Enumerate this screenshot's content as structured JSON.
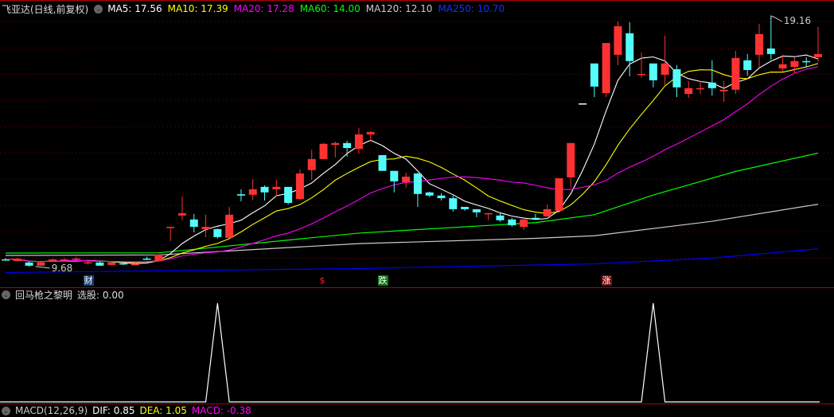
{
  "legend": {
    "stock_title": "飞亚达(日线,前复权)",
    "ma": [
      {
        "label": "MA5: 17.56",
        "color": "#ffffff"
      },
      {
        "label": "MA10: 17.39",
        "color": "#ffff00"
      },
      {
        "label": "MA20: 17.28",
        "color": "#ff00ff"
      },
      {
        "label": "MA60: 14.00",
        "color": "#00ff00"
      },
      {
        "label": "MA120: 12.10",
        "color": "#cccccc"
      },
      {
        "label": "MA250: 10.70",
        "color": "#0000ff"
      }
    ]
  },
  "colors": {
    "up": "#ff3232",
    "down": "#54fcfc",
    "grid": "#7a0000",
    "separator": "#b00000"
  },
  "annotations": {
    "low_label": "9.68",
    "high_label": "19.16"
  },
  "markers": [
    {
      "text": "财",
      "index": 7,
      "bg": "#1c3f77",
      "fg": "#ffffff"
    },
    {
      "text": "$",
      "index": 27,
      "bg": "transparent",
      "fg": "#ff2020"
    },
    {
      "text": "跌",
      "index": 32,
      "bg": "#0a7a0a",
      "fg": "#ffffff"
    },
    {
      "text": "涨",
      "index": 51,
      "bg": "#7a0a0a",
      "fg": "#ffffff"
    }
  ],
  "indicator_panel": {
    "title": "回马枪之黎明",
    "value_label": "选股: 0.00"
  },
  "macd_panel": {
    "title": "MACD(12,26,9)",
    "dif": "DIF: 0.85",
    "dea": "DEA: 1.05",
    "macd": "MACD: -0.38"
  },
  "chart_data": {
    "type": "candlestick",
    "price_range": [
      9.68,
      19.16
    ],
    "candles": [
      [
        9.95,
        9.94,
        10.0,
        9.9
      ],
      [
        9.89,
        9.98,
        10.0,
        9.86
      ],
      [
        9.83,
        9.71,
        9.86,
        9.68
      ],
      [
        9.71,
        9.83,
        9.86,
        9.7
      ],
      [
        9.89,
        9.95,
        9.98,
        9.86
      ],
      [
        9.95,
        9.95,
        10.0,
        9.9
      ],
      [
        9.98,
        9.98,
        10.05,
        9.92
      ],
      [
        9.83,
        9.84,
        9.9,
        9.75
      ],
      [
        9.83,
        9.71,
        9.86,
        9.7
      ],
      [
        9.74,
        9.83,
        9.86,
        9.72
      ],
      [
        9.8,
        9.79,
        9.86,
        9.74
      ],
      [
        9.74,
        9.77,
        9.8,
        9.72
      ],
      [
        9.98,
        9.97,
        10.05,
        9.92
      ],
      [
        9.89,
        10.13,
        10.15,
        9.86
      ],
      [
        11.16,
        11.19,
        11.19,
        10.65
      ],
      [
        11.62,
        11.71,
        12.35,
        11.44
      ],
      [
        11.47,
        11.19,
        11.68,
        10.98
      ],
      [
        11.1,
        11.19,
        11.65,
        10.8
      ],
      [
        11.1,
        10.8,
        11.13,
        10.74
      ],
      [
        10.77,
        11.65,
        11.95,
        10.75
      ],
      [
        12.43,
        12.38,
        12.62,
        12.16
      ],
      [
        12.41,
        12.62,
        13.01,
        12.22
      ],
      [
        12.71,
        12.5,
        12.77,
        12.19
      ],
      [
        12.62,
        12.71,
        12.98,
        12.35
      ],
      [
        12.71,
        12.1,
        12.71,
        12.04
      ],
      [
        12.25,
        13.22,
        13.38,
        12.2
      ],
      [
        13.35,
        13.77,
        14.13,
        12.98
      ],
      [
        13.77,
        14.35,
        14.38,
        13.77
      ],
      [
        14.31,
        14.38,
        14.44,
        13.83
      ],
      [
        14.38,
        14.19,
        14.47,
        13.86
      ],
      [
        14.16,
        14.71,
        14.95,
        13.98
      ],
      [
        14.71,
        14.8,
        14.83,
        14.44
      ],
      [
        13.92,
        13.32,
        13.92,
        13.32
      ],
      [
        13.32,
        12.92,
        13.32,
        12.5
      ],
      [
        12.89,
        13.1,
        13.25,
        12.68
      ],
      [
        13.22,
        12.44,
        13.25,
        11.95
      ],
      [
        12.5,
        12.38,
        12.53,
        12.32
      ],
      [
        12.38,
        12.28,
        12.47,
        12.19
      ],
      [
        12.28,
        11.86,
        12.38,
        11.77
      ],
      [
        11.95,
        11.86,
        11.95,
        11.8
      ],
      [
        11.86,
        11.74,
        11.86,
        11.56
      ],
      [
        11.68,
        11.71,
        11.71,
        11.44
      ],
      [
        11.62,
        11.44,
        11.71,
        11.38
      ],
      [
        11.47,
        11.25,
        11.53,
        11.19
      ],
      [
        11.19,
        11.47,
        11.56,
        11.07
      ],
      [
        11.53,
        11.5,
        11.68,
        11.47
      ],
      [
        11.59,
        11.86,
        12.04,
        11.56
      ],
      [
        11.8,
        13.04,
        13.04,
        11.8
      ],
      [
        13.07,
        14.38,
        14.38,
        12.68
      ],
      [
        15.89,
        15.89,
        15.89,
        15.89
      ],
      [
        17.41,
        16.53,
        17.41,
        16.13
      ],
      [
        16.28,
        18.19,
        18.19,
        16.13
      ],
      [
        17.74,
        18.83,
        19.01,
        17.35
      ],
      [
        18.56,
        17.5,
        18.98,
        16.92
      ],
      [
        16.98,
        17.01,
        17.83,
        16.86
      ],
      [
        17.41,
        16.77,
        17.41,
        16.5
      ],
      [
        16.98,
        17.41,
        18.47,
        16.56
      ],
      [
        17.19,
        16.5,
        17.35,
        16.13
      ],
      [
        16.25,
        16.47,
        16.74,
        16.1
      ],
      [
        16.44,
        16.47,
        16.74,
        16.25
      ],
      [
        16.68,
        16.47,
        17.53,
        16.19
      ],
      [
        16.35,
        16.41,
        16.74,
        15.95
      ],
      [
        16.41,
        17.62,
        17.89,
        16.25
      ],
      [
        17.53,
        17.16,
        17.77,
        16.95
      ],
      [
        17.74,
        18.53,
        18.92,
        17.25
      ],
      [
        17.98,
        17.77,
        19.16,
        17.56
      ],
      [
        17.22,
        17.38,
        17.74,
        17.1
      ],
      [
        17.28,
        17.5,
        17.65,
        17.04
      ],
      [
        17.5,
        17.48,
        17.65,
        17.25
      ],
      [
        17.65,
        17.77,
        18.8,
        17.47
      ]
    ],
    "long_ma": [
      {
        "name": "MA60",
        "color": "#00ff00",
        "points": [
          [
            0,
            10.19
          ],
          [
            13,
            10.2
          ],
          [
            30,
            10.95
          ],
          [
            45,
            11.35
          ],
          [
            50,
            11.65
          ],
          [
            55,
            12.4
          ],
          [
            62,
            13.3
          ],
          [
            69,
            14.0
          ]
        ]
      },
      {
        "name": "MA120",
        "color": "#cccccc",
        "points": [
          [
            0,
            10.1
          ],
          [
            13,
            10.12
          ],
          [
            30,
            10.55
          ],
          [
            45,
            10.75
          ],
          [
            50,
            10.85
          ],
          [
            60,
            11.4
          ],
          [
            69,
            12.05
          ]
        ]
      },
      {
        "name": "MA250",
        "color": "#0000ff",
        "points": [
          [
            0,
            9.45
          ],
          [
            30,
            9.6
          ],
          [
            50,
            9.78
          ],
          [
            60,
            10.0
          ],
          [
            69,
            10.35
          ]
        ]
      }
    ],
    "short_ma": [
      {
        "name": "MA5",
        "period": 5,
        "color": "#ffffff"
      },
      {
        "name": "MA10",
        "period": 10,
        "color": "#ffff00"
      },
      {
        "name": "MA20",
        "period": 20,
        "color": "#ff00ff"
      }
    ],
    "low_index": 2,
    "high_index": 65,
    "signal": {
      "name": "选股",
      "hits": [
        18,
        55
      ],
      "range": [
        0,
        1
      ]
    }
  }
}
